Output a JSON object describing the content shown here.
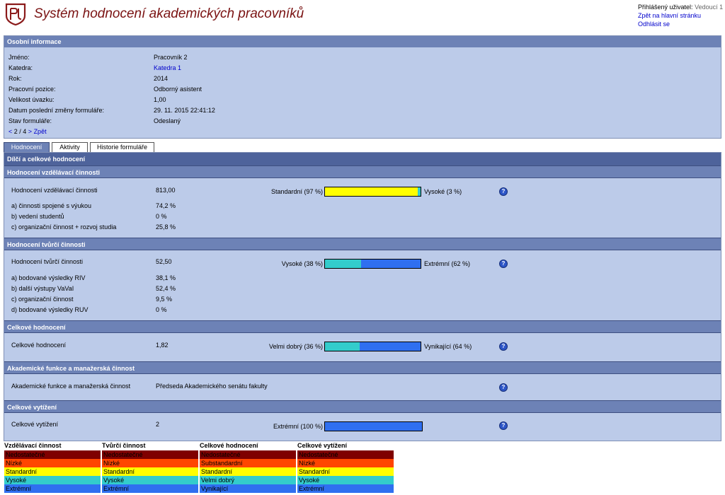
{
  "header": {
    "title": "Systém hodnocení akademických pracovníků",
    "user_label": "Přihlášený uživatel:",
    "user_name": "Vedoucí 1",
    "back_link": "Zpět na hlavní stránku",
    "logout_link": "Odhlásit se"
  },
  "personal_info": {
    "title": "Osobní informace",
    "rows": [
      {
        "label": "Jméno:",
        "value": "Pracovník 2"
      },
      {
        "label": "Katedra:",
        "value": "Katedra 1"
      },
      {
        "label": "Rok:",
        "value": "2014"
      },
      {
        "label": "Pracovní pozice:",
        "value": "Odborný asistent"
      },
      {
        "label": "Velikost úvazku:",
        "value": "1,00"
      },
      {
        "label": "Datum poslední změny formuláře:",
        "value": "29. 11. 2015 22:41:12"
      },
      {
        "label": "Stav formuláře:",
        "value": "Odeslaný"
      }
    ],
    "nav_prev": "<",
    "nav_pos": " 2 / 4 ",
    "nav_next": ">",
    "nav_back": "Zpět"
  },
  "tabs": [
    "Hodnocení",
    "Aktivity",
    "Historie formuláře"
  ],
  "main_title": "Dílčí a celkové hodnocení",
  "sections": {
    "teaching": {
      "title": "Hodnocení vzdělávací činnosti",
      "label": "Hodnocení vzdělávací činnosti",
      "value": "813,00",
      "left_label": "Standardní (97 %)",
      "right_label": "Vysoké (3 %)",
      "left_pct": 97,
      "items": [
        {
          "label": "a) činnosti spojené s výukou",
          "value": "74,2 %"
        },
        {
          "label": "b) vedení studentů",
          "value": "0 %"
        },
        {
          "label": "c) organizační činnost + rozvoj studia",
          "value": "25,8 %"
        }
      ]
    },
    "creative": {
      "title": "Hodnocení tvůrčí činnosti",
      "label": "Hodnocení tvůrčí činnosti",
      "value": "52,50",
      "left_label": "Vysoké (38 %)",
      "right_label": "Extrémní (62 %)",
      "left_pct": 38,
      "items": [
        {
          "label": "a) bodované výsledky RIV",
          "value": "38,1 %"
        },
        {
          "label": "b) další výstupy VaVaI",
          "value": "52,4 %"
        },
        {
          "label": "c) organizační činnost",
          "value": "9,5 %"
        },
        {
          "label": "d) bodované výsledky RUV",
          "value": "0 %"
        }
      ]
    },
    "overall": {
      "title": "Celkové hodnocení",
      "label": "Celkové hodnocení",
      "value": "1,82",
      "left_label": "Velmi dobrý (36 %)",
      "right_label": "Vynikající (64 %)",
      "left_pct": 36
    },
    "academic": {
      "title": "Akademické funkce a manažerská činnost",
      "label": "Akademické funkce a manažerská činnost",
      "value": "Předseda Akademického senátu fakulty"
    },
    "load": {
      "title": "Celkové vytížení",
      "label": "Celkové vytížení",
      "value": "2",
      "left_label": "Extrémní (100 %)",
      "left_pct": 100
    }
  },
  "help_icon": "?",
  "colors": {
    "yellow": "#ffff00",
    "teal": "#33cccc",
    "blue": "#2f6ff0",
    "dark_red": "#7f0000",
    "orange_red": "#ff4500"
  },
  "legend": [
    {
      "title": "Vzdělávací činnost",
      "items": [
        "Nedostatečné",
        "Nízké",
        "Standardní",
        "Vysoké",
        "Extrémní"
      ]
    },
    {
      "title": "Tvůrčí činnost",
      "items": [
        "Nedostatečné",
        "Nízké",
        "Standardní",
        "Vysoké",
        "Extrémní"
      ]
    },
    {
      "title": "Celkové hodnocení",
      "items": [
        "Nedostatečné",
        "Substandardní",
        "Standardní",
        "Velmi dobrý",
        "Vynikající"
      ]
    },
    {
      "title": "Celkové vytížení",
      "items": [
        "Nedostatečné",
        "Nízké",
        "Standardní",
        "Vysoké",
        "Extrémní"
      ]
    }
  ],
  "legend_colors": [
    "#7f0000",
    "#ff4500",
    "#ffff00",
    "#33cccc",
    "#2f6ff0"
  ]
}
